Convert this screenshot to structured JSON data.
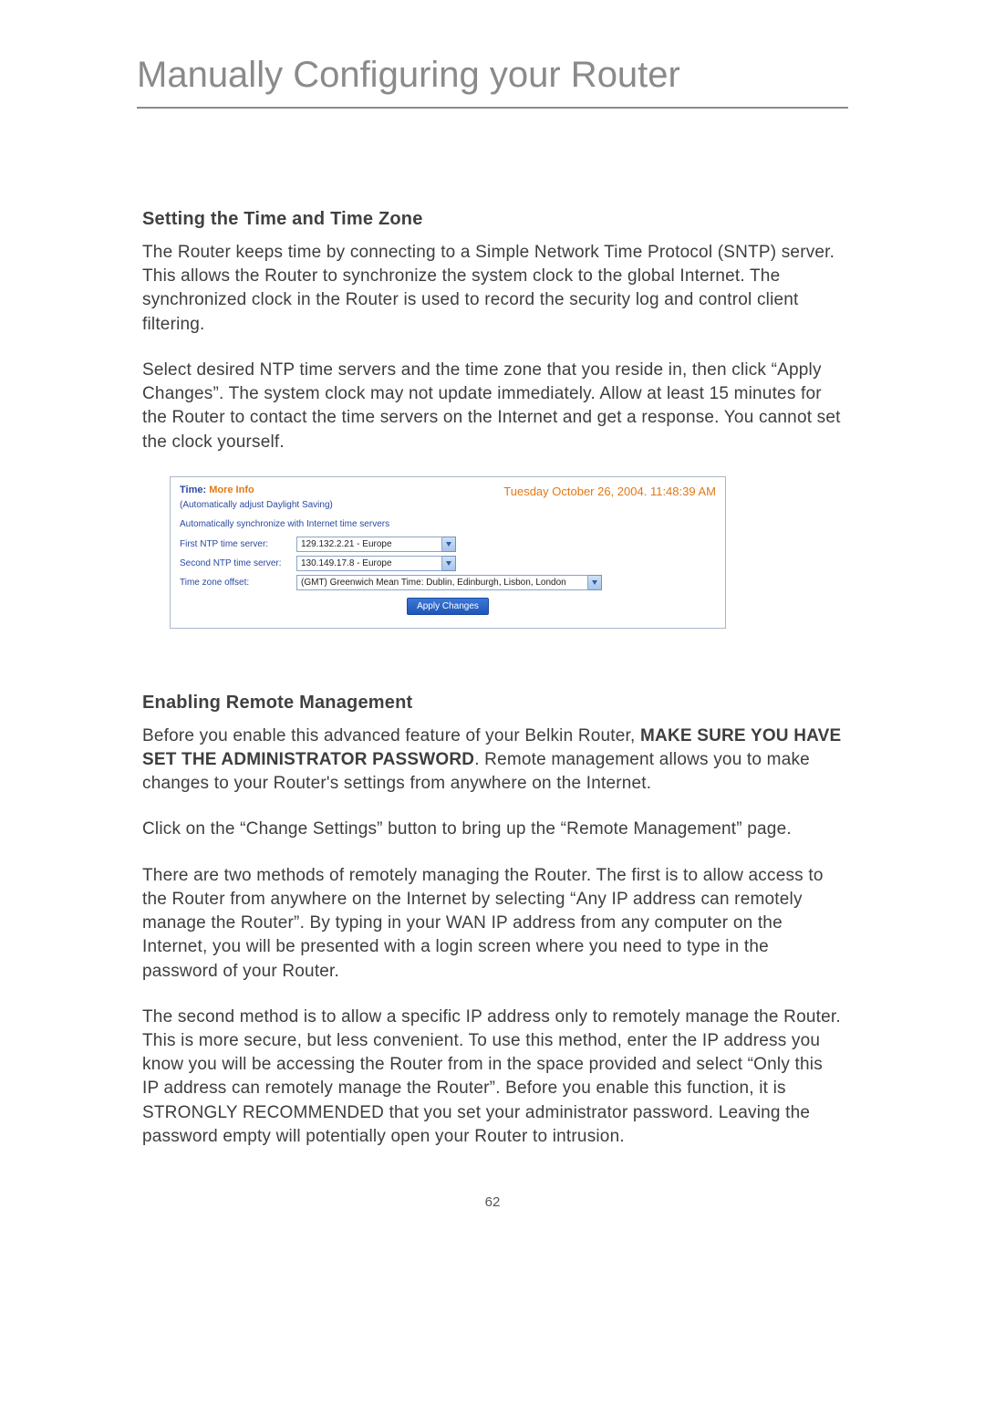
{
  "title": "Manually Configuring your Router",
  "section1": {
    "heading": "Setting the Time and Time Zone",
    "p1": "The Router keeps time by connecting to a Simple Network Time Protocol (SNTP) server. This allows the Router to synchronize the system clock to the global Internet. The synchronized clock in the Router is used to record the security log and control client filtering.",
    "p2": "Select desired NTP time servers and the time zone that you reside in, then click “Apply Changes”. The system clock may not update immediately. Allow at least 15 minutes for the Router to contact the time servers on the Internet and get a response. You cannot set the clock yourself."
  },
  "figure": {
    "time_label": "Time:",
    "more_info": "More Info",
    "dst": "(Automatically adjust Daylight Saving)",
    "date": "Tuesday October 26, 2004.  11:48:39 AM",
    "autosync": "Automatically synchronize with Internet time servers",
    "labels": {
      "first": "First NTP time server:",
      "second": "Second NTP time server:",
      "tz": "Time zone offset:"
    },
    "values": {
      "first": "129.132.2.21 - Europe",
      "second": "130.149.17.8 - Europe",
      "tz": "(GMT) Greenwich Mean Time: Dublin, Edinburgh, Lisbon, London"
    },
    "apply": "Apply Changes"
  },
  "section2": {
    "heading": "Enabling Remote Management",
    "p1a": "Before you enable this advanced feature of your Belkin Router, ",
    "p1b": "MAKE SURE YOU HAVE SET THE ADMINISTRATOR PASSWORD",
    "p1c": ". Remote management allows you to make changes to your Router's settings from anywhere on the Internet.",
    "p2": "Click on the “Change Settings” button to bring up the “Remote Management” page.",
    "p3": "There are two methods of remotely managing the Router. The first is to allow access to the Router from anywhere on the Internet by selecting “Any IP address can remotely manage the Router”. By typing in your WAN IP address from any computer on the Internet, you will be presented with a login screen where you need to type in the password of your Router.",
    "p4": "The second method is to allow a specific IP address only to remotely manage the Router. This is more secure, but less convenient. To use this method, enter the IP address you know you will be accessing the Router from in the space provided and select “Only this IP address can remotely manage the Router”. Before you enable this function, it is STRONGLY RECOMMENDED that you set your administrator password. Leaving the password empty will potentially open your Router to intrusion."
  },
  "pagenum": "62"
}
